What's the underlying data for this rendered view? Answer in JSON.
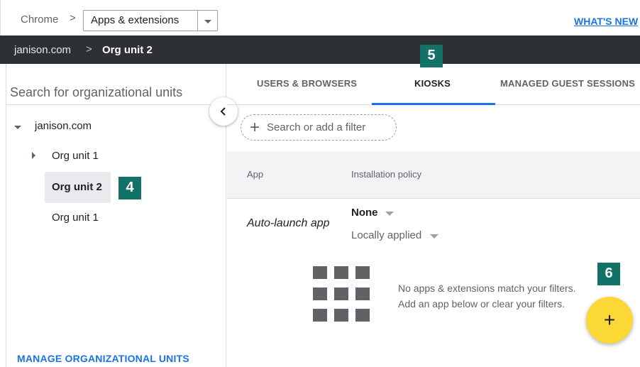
{
  "topbar": {
    "breadcrumb_root": "Chrome",
    "breadcrumb_separator": ">",
    "selector_value": "Apps & extensions",
    "whats_new": "WHAT'S NEW"
  },
  "orgbar": {
    "root": "janison.com",
    "separator": ">",
    "current": "Org unit 2"
  },
  "sidebar": {
    "search_placeholder": "Search for organizational units",
    "tree": [
      {
        "label": "janison.com",
        "expanded": true
      },
      {
        "label": "Org unit 1",
        "expanded": false
      },
      {
        "label": "Org unit 2",
        "selected": true
      },
      {
        "label": "Org unit 1"
      }
    ],
    "manage_link": "MANAGE ORGANIZATIONAL UNITS",
    "collapse_icon": "chevron-left-icon"
  },
  "tabs": [
    {
      "label": "USERS & BROWSERS",
      "active": false
    },
    {
      "label": "KIOSKS",
      "active": true
    },
    {
      "label": "MANAGED GUEST SESSIONS",
      "active": false
    }
  ],
  "filter": {
    "placeholder": "Search or add a filter",
    "icon": "plus-icon"
  },
  "table": {
    "columns": [
      "App",
      "Installation policy"
    ],
    "row": {
      "app": "Auto-launch app",
      "policy": "None",
      "source": "Locally applied"
    }
  },
  "empty_state": {
    "icon": "apps-grid-icon",
    "line1": "No apps & extensions match your filters.",
    "line2": "Add an app below or clear your filters."
  },
  "fab": {
    "icon": "+",
    "color": "#fcd837"
  },
  "callouts": [
    "4",
    "5",
    "6"
  ],
  "colors": {
    "accent": "#1a73e8",
    "callout": "#137268",
    "dark_bar": "#2d3134"
  }
}
